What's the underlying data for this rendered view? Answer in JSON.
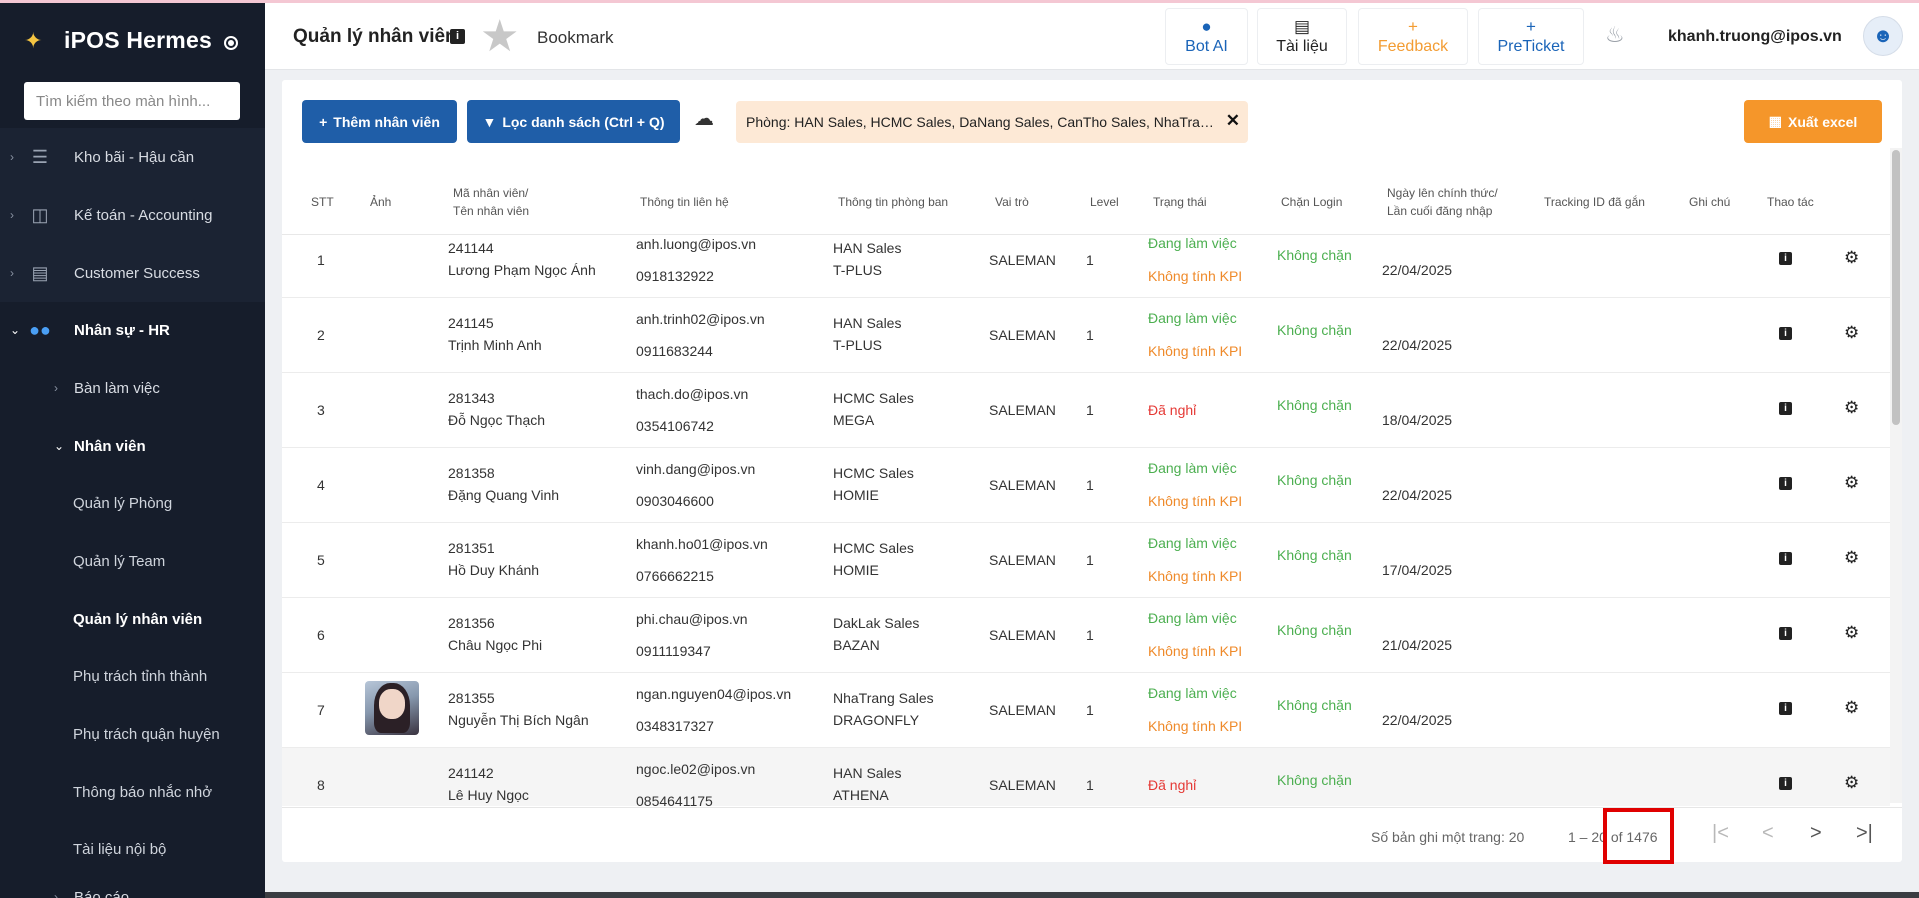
{
  "sidebar": {
    "brand": "iPOS Hermes",
    "search_placeholder": "Tìm kiếm theo màn hình...",
    "groups": [
      {
        "label": "Kho bãi - Hậu cần",
        "icon": "server-icon"
      },
      {
        "label": "Kế toán - Accounting",
        "icon": "chart-box-icon"
      },
      {
        "label": "Customer Success",
        "icon": "id-card-icon"
      },
      {
        "label": "Nhân sự - HR",
        "icon": "users-icon"
      }
    ],
    "sub": [
      {
        "label": "Bàn làm việc"
      },
      {
        "label": "Nhân viên"
      }
    ],
    "leaves": [
      {
        "label": "Quản lý Phòng"
      },
      {
        "label": "Quản lý Team"
      },
      {
        "label": "Quản lý nhân viên"
      },
      {
        "label": "Phụ trách tỉnh thành"
      },
      {
        "label": "Phụ trách quận huyện"
      },
      {
        "label": "Thông báo nhắc nhở"
      },
      {
        "label": "Tài liệu nội bộ"
      },
      {
        "label": "Báo cáo"
      }
    ]
  },
  "header": {
    "title": "Quản lý nhân viên",
    "bookmark": "Bookmark",
    "buttons": [
      {
        "label": "Bot AI",
        "icon": "chat-icon"
      },
      {
        "label": "Tài liệu",
        "icon": "book-icon"
      },
      {
        "label": "Feedback",
        "icon": "plus-icon"
      },
      {
        "label": "PreTicket",
        "icon": "plus-icon"
      }
    ],
    "user_email": "khanh.truong@ipos.vn"
  },
  "toolbar": {
    "add_label": "Thêm nhân viên",
    "filter_label": "Lọc danh sách (Ctrl + Q)",
    "chip": "Phòng: HAN Sales, HCMC Sales, DaNang Sales, CanTho Sales, NhaTrang...",
    "export_label": "Xuất excel"
  },
  "table": {
    "headers": {
      "stt": "STT",
      "photo": "Ảnh",
      "code1": "Mã nhân viên/",
      "code2": "Tên nhân viên",
      "contact": "Thông tin liên hệ",
      "dept": "Thông tin phòng ban",
      "role": "Vai trò",
      "level": "Level",
      "status": "Trạng thái",
      "block": "Chặn Login",
      "date1": "Ngày lên chính thức/",
      "date2": "Lần cuối đăng nhập",
      "tracking": "Tracking ID đã gắn",
      "note": "Ghi chú",
      "actions": "Thao tác"
    },
    "rows": [
      {
        "stt": "1",
        "id": "241144",
        "name": "Lương Phạm Ngọc Ánh",
        "email": "anh.luong@ipos.vn",
        "phone": "0918132922",
        "dept": "HAN Sales",
        "team": "T-PLUS",
        "role": "SALEMAN",
        "level": "1",
        "status": "Đang làm việc",
        "kpi": "Không tính KPI",
        "block": "Không chặn",
        "date": "22/04/2025"
      },
      {
        "stt": "2",
        "id": "241145",
        "name": "Trịnh Minh Anh",
        "email": "anh.trinh02@ipos.vn",
        "phone": "0911683244",
        "dept": "HAN Sales",
        "team": "T-PLUS",
        "role": "SALEMAN",
        "level": "1",
        "status": "Đang làm việc",
        "kpi": "Không tính KPI",
        "block": "Không chặn",
        "date": "22/04/2025"
      },
      {
        "stt": "3",
        "id": "281343",
        "name": "Đỗ Ngọc Thạch",
        "email": "thach.do@ipos.vn",
        "phone": "0354106742",
        "dept": "HCMC Sales",
        "team": "MEGA",
        "role": "SALEMAN",
        "level": "1",
        "status": "Đã nghỉ",
        "kpi": "",
        "block": "Không chặn",
        "date": "18/04/2025"
      },
      {
        "stt": "4",
        "id": "281358",
        "name": "Đặng Quang Vinh",
        "email": "vinh.dang@ipos.vn",
        "phone": "0903046600",
        "dept": "HCMC Sales",
        "team": "HOMIE",
        "role": "SALEMAN",
        "level": "1",
        "status": "Đang làm việc",
        "kpi": "Không tính KPI",
        "block": "Không chặn",
        "date": "22/04/2025"
      },
      {
        "stt": "5",
        "id": "281351",
        "name": "Hồ Duy Khánh",
        "email": "khanh.ho01@ipos.vn",
        "phone": "0766662215",
        "dept": "HCMC Sales",
        "team": "HOMIE",
        "role": "SALEMAN",
        "level": "1",
        "status": "Đang làm việc",
        "kpi": "Không tính KPI",
        "block": "Không chặn",
        "date": "17/04/2025"
      },
      {
        "stt": "6",
        "id": "281356",
        "name": "Châu Ngọc Phi",
        "email": "phi.chau@ipos.vn",
        "phone": "0911119347",
        "dept": "DakLak Sales",
        "team": "BAZAN",
        "role": "SALEMAN",
        "level": "1",
        "status": "Đang làm việc",
        "kpi": "Không tính KPI",
        "block": "Không chặn",
        "date": "21/04/2025"
      },
      {
        "stt": "7",
        "id": "281355",
        "name": "Nguyễn Thị Bích Ngân",
        "email": "ngan.nguyen04@ipos.vn",
        "phone": "0348317327",
        "dept": "NhaTrang Sales",
        "team": "DRAGONFLY",
        "role": "SALEMAN",
        "level": "1",
        "status": "Đang làm việc",
        "kpi": "Không tính KPI",
        "block": "Không chặn",
        "date": "22/04/2025",
        "photo": true
      },
      {
        "stt": "8",
        "id": "241142",
        "name": "Lê Huy Ngọc",
        "email": "ngoc.le02@ipos.vn",
        "phone": "0854641175",
        "dept": "HAN Sales",
        "team": "ATHENA",
        "role": "SALEMAN",
        "level": "1",
        "status": "Đã nghỉ",
        "kpi": "",
        "block": "Không chặn",
        "date": ""
      }
    ]
  },
  "pager": {
    "page_size": "Số bản ghi một trang: 20",
    "range": "1 – 20 of 1476"
  },
  "colors": {
    "primary": "#1f5ea8",
    "accent": "#f5962a",
    "active_status": "#4caf50",
    "kpi": "#ef8a2a",
    "quit": "#e53935",
    "sidebar": "#161d2b"
  }
}
